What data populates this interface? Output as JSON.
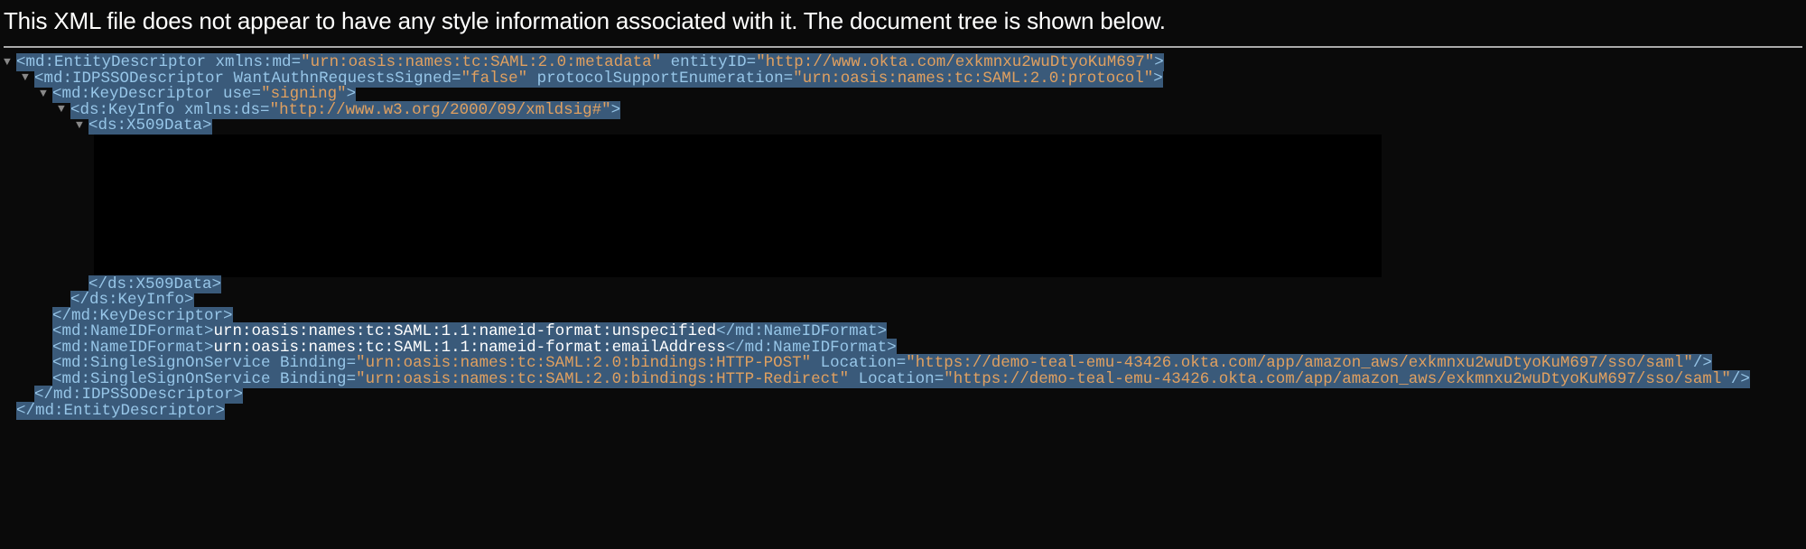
{
  "header_msg": "This XML file does not appear to have any style information associated with it. The document tree is shown below.",
  "lines": {
    "l1_tag_open": "<md:EntityDescriptor",
    "l1_attr1_name": " xmlns:md",
    "l1_attr1_val": "\"urn:oasis:names:tc:SAML:2.0:metadata\"",
    "l1_attr2_name": " entityID",
    "l1_attr2_val": "\"http://www.okta.com/exkmnxu2wuDtyoKuM697\"",
    "l1_close": ">",
    "l2_tag_open": "<md:IDPSSODescriptor",
    "l2_attr1_name": " WantAuthnRequestsSigned",
    "l2_attr1_val": "\"false\"",
    "l2_attr2_name": " protocolSupportEnumeration",
    "l2_attr2_val": "\"urn:oasis:names:tc:SAML:2.0:protocol\"",
    "l2_close": ">",
    "l3_tag_open": "<md:KeyDescriptor",
    "l3_attr1_name": " use",
    "l3_attr1_val": "\"signing\"",
    "l3_close": ">",
    "l4_tag_open": "<ds:KeyInfo",
    "l4_attr1_name": " xmlns:ds",
    "l4_attr1_val": "\"http://www.w3.org/2000/09/xmldsig#\"",
    "l4_close": ">",
    "l5_tag_open": "<ds:X509Data>",
    "l6_close_tag": "</ds:X509Data>",
    "l7_close_tag": "</ds:KeyInfo>",
    "l8_close_tag": "</md:KeyDescriptor>",
    "l9_tag_open": "<md:NameIDFormat>",
    "l9_text": "urn:oasis:names:tc:SAML:1.1:nameid-format:unspecified",
    "l9_tag_close": "</md:NameIDFormat>",
    "l10_tag_open": "<md:NameIDFormat>",
    "l10_text": "urn:oasis:names:tc:SAML:1.1:nameid-format:emailAddress",
    "l10_tag_close": "</md:NameIDFormat>",
    "l11_tag_open": "<md:SingleSignOnService",
    "l11_attr1_name": " Binding",
    "l11_attr1_val": "\"urn:oasis:names:tc:SAML:2.0:bindings:HTTP-POST\"",
    "l11_attr2_name": " Location",
    "l11_attr2_val": "\"https://demo-teal-emu-43426.okta.com/app/amazon_aws/exkmnxu2wuDtyoKuM697/sso/saml\"",
    "l11_close": "/>",
    "l12_tag_open": "<md:SingleSignOnService",
    "l12_attr1_name": " Binding",
    "l12_attr1_val": "\"urn:oasis:names:tc:SAML:2.0:bindings:HTTP-Redirect\"",
    "l12_attr2_name": " Location",
    "l12_attr2_val": "\"https://demo-teal-emu-43426.okta.com/app/amazon_aws/exkmnxu2wuDtyoKuM697/sso/saml\"",
    "l12_close": "/>",
    "l13_close_tag": "</md:IDPSSODescriptor>",
    "l14_close_tag": "</md:EntityDescriptor>"
  }
}
